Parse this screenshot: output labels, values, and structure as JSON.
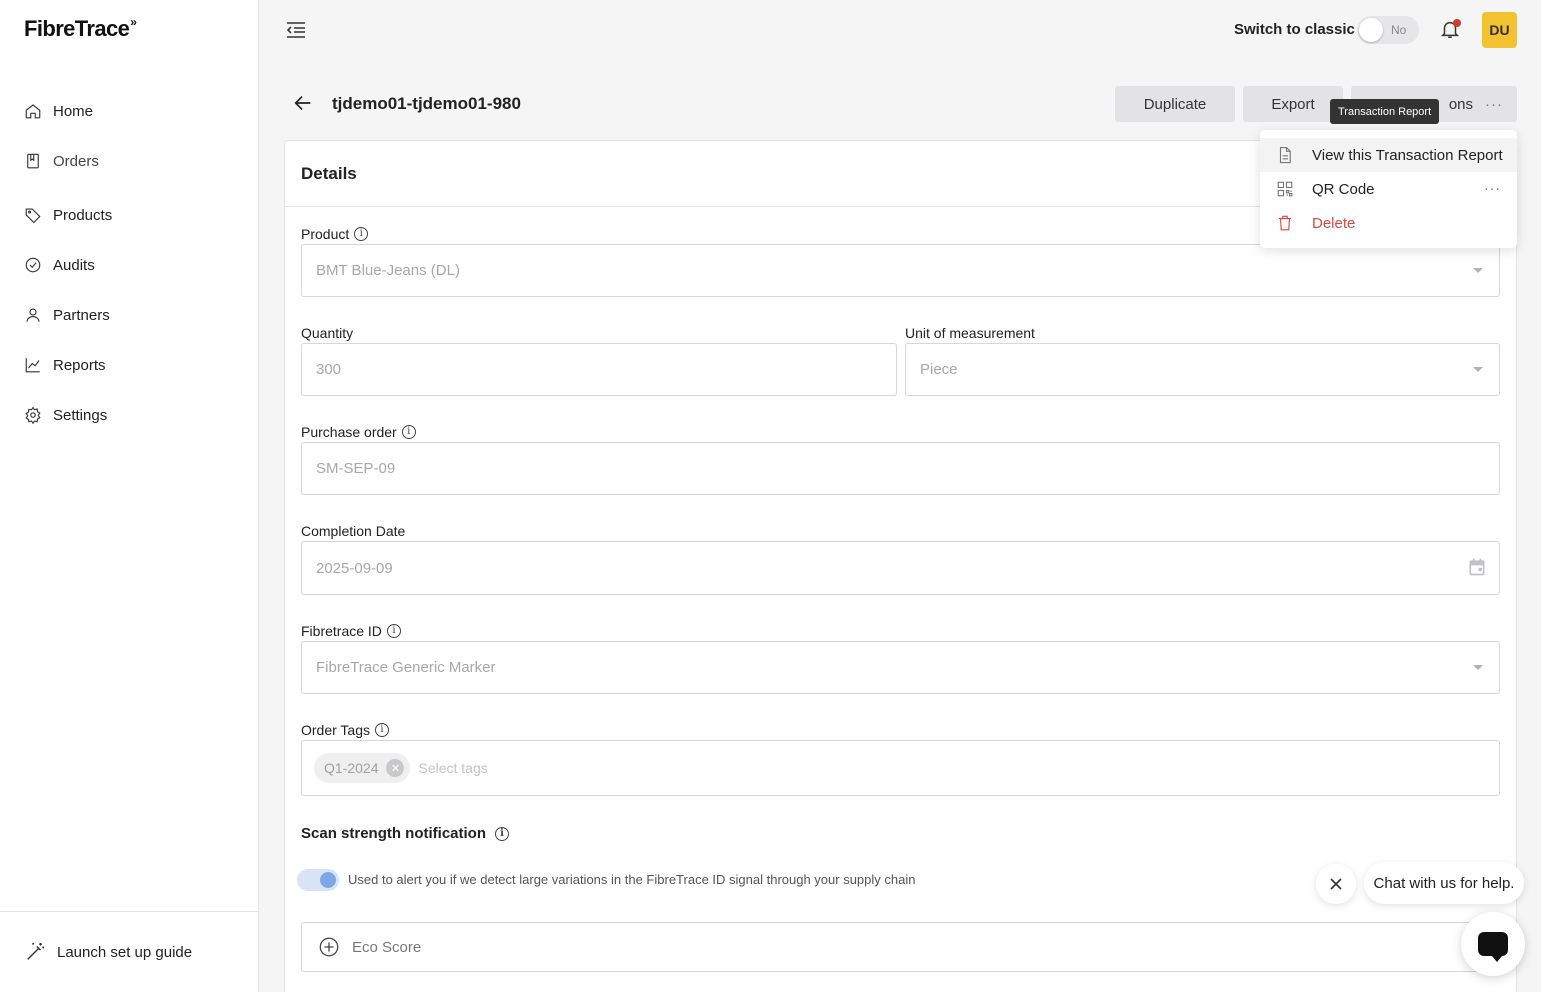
{
  "app": {
    "logo_text": "FibreTrace",
    "logo_mark": "»"
  },
  "sidebar": {
    "items": [
      {
        "label": "Home",
        "icon": "home-icon"
      },
      {
        "label": "Orders",
        "icon": "orders-icon"
      },
      {
        "label": "Products",
        "icon": "tag-icon"
      },
      {
        "label": "Audits",
        "icon": "check-circle-icon"
      },
      {
        "label": "Partners",
        "icon": "user-icon"
      },
      {
        "label": "Reports",
        "icon": "chart-icon"
      },
      {
        "label": "Settings",
        "icon": "gear-icon"
      }
    ],
    "footer_label": "Launch set up guide"
  },
  "topbar": {
    "switch_label": "Switch to classic",
    "switch_state": "No",
    "avatar_initials": "DU",
    "avatar_color": "#f2c230"
  },
  "header": {
    "title": "tjdemo01-tjdemo01-980",
    "duplicate_label": "Duplicate",
    "export_label": "Export",
    "actions_label": "ons",
    "actions_more": "···",
    "tooltip": "Transaction Report"
  },
  "dropdown": {
    "items": [
      {
        "label": "View this Transaction Report",
        "icon": "document-icon"
      },
      {
        "label": "QR Code",
        "icon": "qr-code-icon",
        "more": "···"
      },
      {
        "label": "Delete",
        "icon": "trash-icon",
        "color": "#e0483f"
      }
    ]
  },
  "details": {
    "title": "Details",
    "product_label": "Product",
    "product_value": "BMT Blue-Jeans (DL)",
    "quantity_label": "Quantity",
    "quantity_value": "300",
    "unit_label": "Unit of measurement",
    "unit_value": "Piece",
    "po_label": "Purchase order",
    "po_value": "SM-SEP-09",
    "completion_label": "Completion Date",
    "completion_value": "2025-09-09",
    "fibretrace_label": "Fibretrace ID",
    "fibretrace_value": "FibreTrace Generic Marker",
    "tags_label": "Order Tags",
    "tags": [
      "Q1-2024"
    ],
    "tags_placeholder": "Select tags",
    "scan_title": "Scan strength notification",
    "scan_description": "Used to alert you if we detect large variations in the FibreTrace ID signal through your supply chain",
    "scan_enabled": true,
    "eco_label": "Eco Score"
  },
  "chat": {
    "bubble_text": "Chat with us for help."
  }
}
